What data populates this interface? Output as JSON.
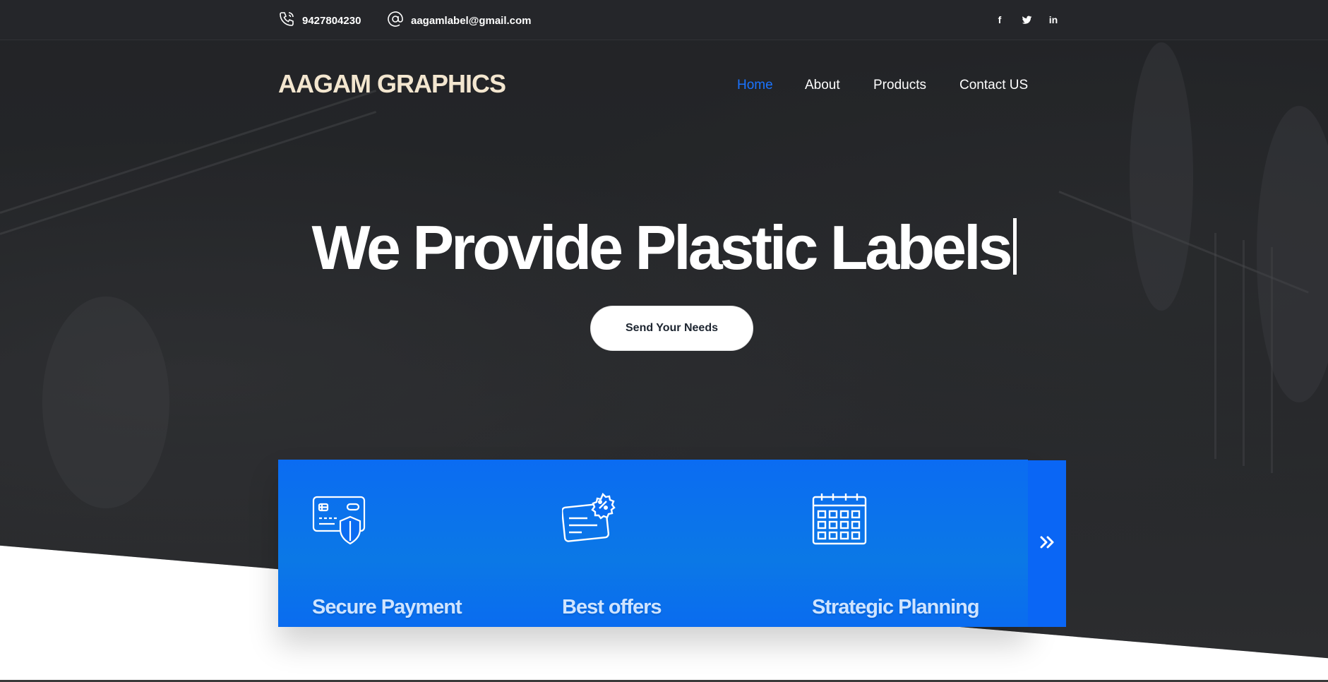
{
  "topbar": {
    "phone": "9427804230",
    "email": "aagamlabel@gmail.com",
    "social": [
      {
        "name": "facebook",
        "glyph": "f"
      },
      {
        "name": "twitter",
        "glyph": "t"
      },
      {
        "name": "linkedin",
        "glyph": "in"
      }
    ]
  },
  "header": {
    "logo": "AAGAM GRAPHICS",
    "nav": [
      {
        "label": "Home",
        "active": true
      },
      {
        "label": "About",
        "active": false
      },
      {
        "label": "Products",
        "active": false
      },
      {
        "label": "Contact US",
        "active": false
      }
    ]
  },
  "hero": {
    "headline": "We Provide Plastic Labels",
    "cta_label": "Send Your Needs"
  },
  "features": {
    "items": [
      {
        "title": "Secure Payment",
        "icon": "credit-card-shield-icon"
      },
      {
        "title": "Best offers",
        "icon": "discount-card-icon"
      },
      {
        "title": "Strategic Planning",
        "icon": "calendar-icon"
      }
    ],
    "next_icon": "double-chevron-right-icon"
  },
  "colors": {
    "accent": "#0b6cf2",
    "nav_active": "#1a73ff",
    "logo": "#f3e6cf",
    "feature_title": "#cfe4ff"
  }
}
